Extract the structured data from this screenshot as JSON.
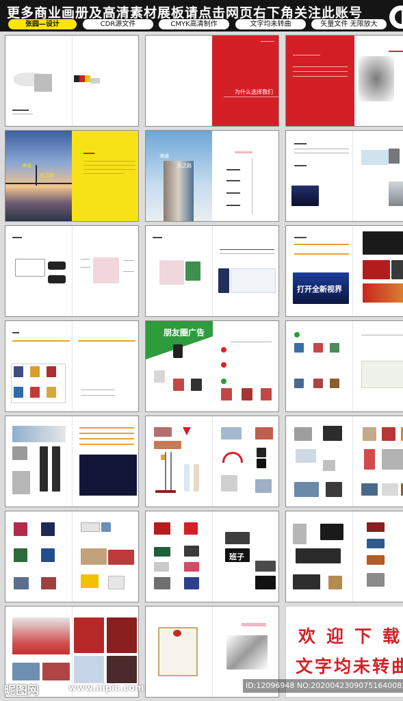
{
  "header": {
    "title": "更多商业画册及高清素材展板请点击网页右下角关注此账号",
    "tags": [
      "张园—设计",
      "CDR源文件",
      "CMYK高清制作",
      "文字均未转曲",
      "矢量文件 无限放大"
    ]
  },
  "spreads": [
    {
      "row": 1,
      "col": 1,
      "kind": "cover"
    },
    {
      "row": 1,
      "col": 2,
      "kind": "red-title",
      "text": "为什么选择我们"
    },
    {
      "row": 1,
      "col": 3,
      "kind": "red-horse"
    },
    {
      "row": 2,
      "col": 1,
      "kind": "bridge-yellow",
      "slogan_top": "海通",
      "slogan_bottom": "光之路"
    },
    {
      "row": 2,
      "col": 2,
      "kind": "building-timeline",
      "slogan_top": "海通",
      "slogan_bottom": "光之路"
    },
    {
      "row": 2,
      "col": 3,
      "kind": "text-photos"
    },
    {
      "row": 3,
      "col": 1,
      "kind": "product-list"
    },
    {
      "row": 3,
      "col": 2,
      "kind": "product-table"
    },
    {
      "row": 3,
      "col": 3,
      "kind": "screens",
      "banner_text": "打开全新视界"
    },
    {
      "row": 4,
      "col": 1,
      "kind": "catalog-grid"
    },
    {
      "row": 4,
      "col": 2,
      "kind": "green-ad",
      "title": "朋友圈广告"
    },
    {
      "row": 4,
      "col": 3,
      "kind": "map-grid"
    },
    {
      "row": 5,
      "col": 1,
      "kind": "kiosks"
    },
    {
      "row": 5,
      "col": 2,
      "kind": "flags"
    },
    {
      "row": 5,
      "col": 3,
      "kind": "print-items"
    },
    {
      "row": 6,
      "col": 1,
      "kind": "signs"
    },
    {
      "row": 6,
      "col": 2,
      "kind": "letters",
      "sign_text": "班子"
    },
    {
      "row": 6,
      "col": 3,
      "kind": "neon-signs"
    },
    {
      "row": 7,
      "col": 1,
      "kind": "culture-wall"
    },
    {
      "row": 7,
      "col": 2,
      "kind": "certificate"
    },
    {
      "row": 7,
      "col": 3,
      "kind": "welcome",
      "line1": "欢迎下载",
      "line2": "文字均未转曲"
    }
  ],
  "watermark": {
    "logo": "昵图网",
    "url": "www.nipic.com",
    "id_text": "ID:12096948 NO:20200423090751640082"
  }
}
